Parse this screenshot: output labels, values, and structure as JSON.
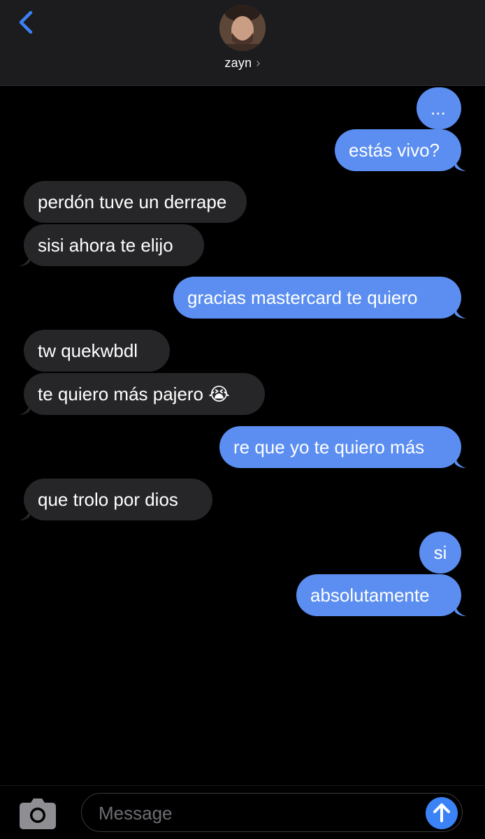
{
  "header": {
    "contact_name": "zayn",
    "chevron": "›"
  },
  "messages": [
    {
      "side": "sent",
      "text": "..."
    },
    {
      "side": "sent",
      "text": "estás vivo?"
    },
    {
      "side": "recv",
      "text": "perdón tuve un derrape"
    },
    {
      "side": "recv",
      "text": "sisi ahora te elijo"
    },
    {
      "side": "sent",
      "text": "gracias mastercard te quiero"
    },
    {
      "side": "recv",
      "text": "tw quekwbdl"
    },
    {
      "side": "recv",
      "text": "te quiero más pajero 😭"
    },
    {
      "side": "sent",
      "text": "re que yo te quiero más"
    },
    {
      "side": "recv",
      "text": "que trolo por dios"
    },
    {
      "side": "sent",
      "text": "si"
    },
    {
      "side": "sent",
      "text": "absolutamente"
    }
  ],
  "composer": {
    "placeholder": "Message"
  },
  "colors": {
    "sent_bubble": "#5b8ef0",
    "received_bubble": "#262629",
    "accent": "#3b82f6"
  },
  "icons": {
    "back": "chevron-left-icon",
    "camera": "camera-icon",
    "send": "arrow-up-icon"
  }
}
